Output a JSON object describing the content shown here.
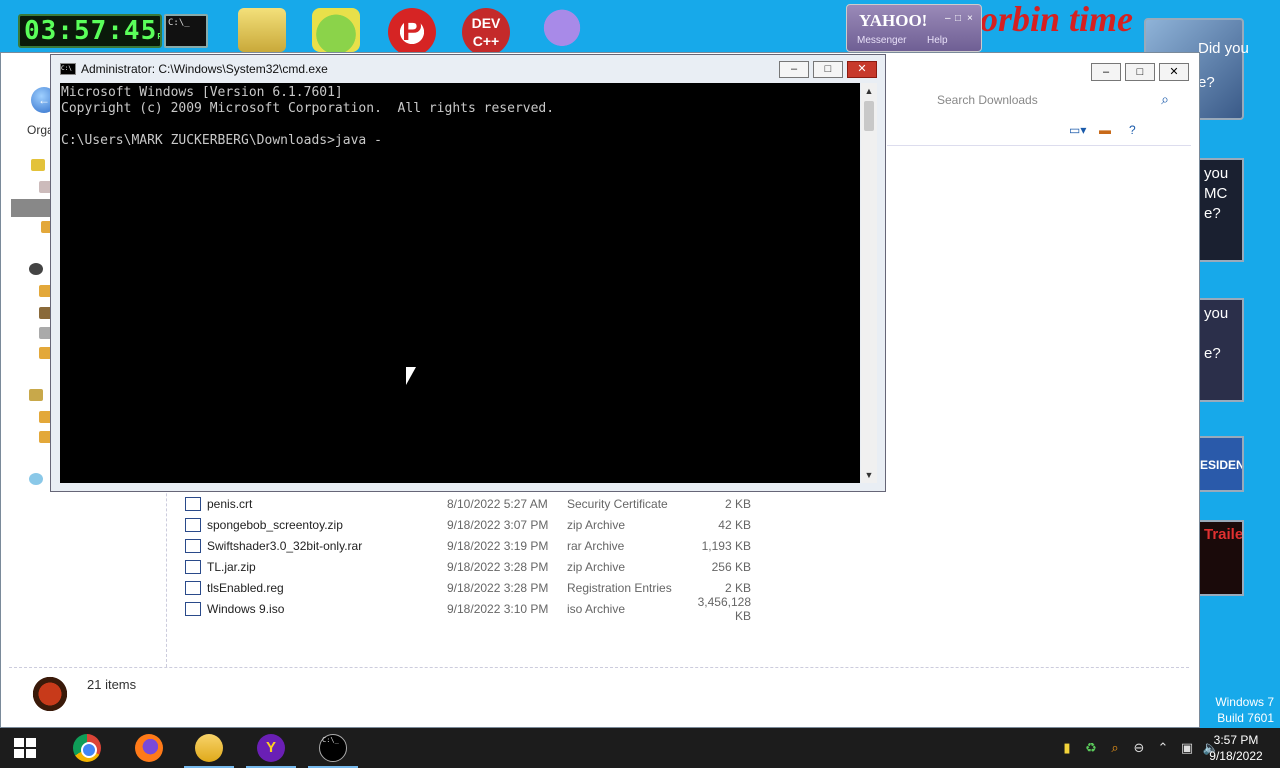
{
  "desktop": {
    "clock_time": "03:57:45",
    "clock_ampm": "PM",
    "icons": [
      "cmd-icon",
      "printer-icon",
      "pig-game-icon",
      "p-app-icon",
      "dev-cpp-icon",
      "bird-icon"
    ],
    "dev_label": "DEV\nC++",
    "p_label": "P",
    "cmd_label": "C:\\_",
    "banner_text": "orbin time",
    "os_line1": "Windows 7",
    "os_line2": "Build 7601",
    "ads": {
      "ad1_text": "you\nMC\ne?",
      "ad2_text": "you\n\ne?",
      "ad3_text": "ESIDENT",
      "ad4_text": "Trailer",
      "photo_top_text": "Did you\n\ne?"
    }
  },
  "yahoo_widget": {
    "brand": "YAHOO!",
    "menu1": "Messenger",
    "menu2": "Help"
  },
  "explorer": {
    "search_placeholder": "Search Downloads",
    "organize_label": "Orga",
    "status_count": "21 items",
    "files": [
      {
        "name": "penis.crt",
        "date": "8/10/2022 5:27 AM",
        "type": "Security Certificate",
        "size": "2 KB"
      },
      {
        "name": "spongebob_screentoy.zip",
        "date": "9/18/2022 3:07 PM",
        "type": "zip Archive",
        "size": "42 KB"
      },
      {
        "name": "Swiftshader3.0_32bit-only.rar",
        "date": "9/18/2022 3:19 PM",
        "type": "rar Archive",
        "size": "1,193 KB"
      },
      {
        "name": "TL.jar.zip",
        "date": "9/18/2022 3:28 PM",
        "type": "zip Archive",
        "size": "256 KB"
      },
      {
        "name": "tlsEnabled.reg",
        "date": "9/18/2022 3:28 PM",
        "type": "Registration Entries",
        "size": "2 KB"
      },
      {
        "name": "Windows 9.iso",
        "date": "9/18/2022 3:10 PM",
        "type": "iso Archive",
        "size": "3,456,128 KB"
      }
    ]
  },
  "cmd": {
    "title": "Administrator: C:\\Windows\\System32\\cmd.exe",
    "lines": [
      "Microsoft Windows [Version 6.1.7601]",
      "Copyright (c) 2009 Microsoft Corporation.  All rights reserved.",
      "",
      "C:\\Users\\MARK ZUCKERBERG\\Downloads>java -"
    ]
  },
  "taskbar": {
    "apps": [
      "chrome",
      "firefox",
      "file-explorer",
      "yahoo-messenger",
      "cmd"
    ],
    "yahoo_glyph": "Y",
    "time": "3:57 PM",
    "date": "9/18/2022"
  },
  "colors": {
    "desktop_bg": "#17a9ea",
    "taskbar_bg": "#1c1c1c",
    "close_red": "#c7392b",
    "console_bg": "#000000",
    "console_fg": "#c8c8c8"
  }
}
